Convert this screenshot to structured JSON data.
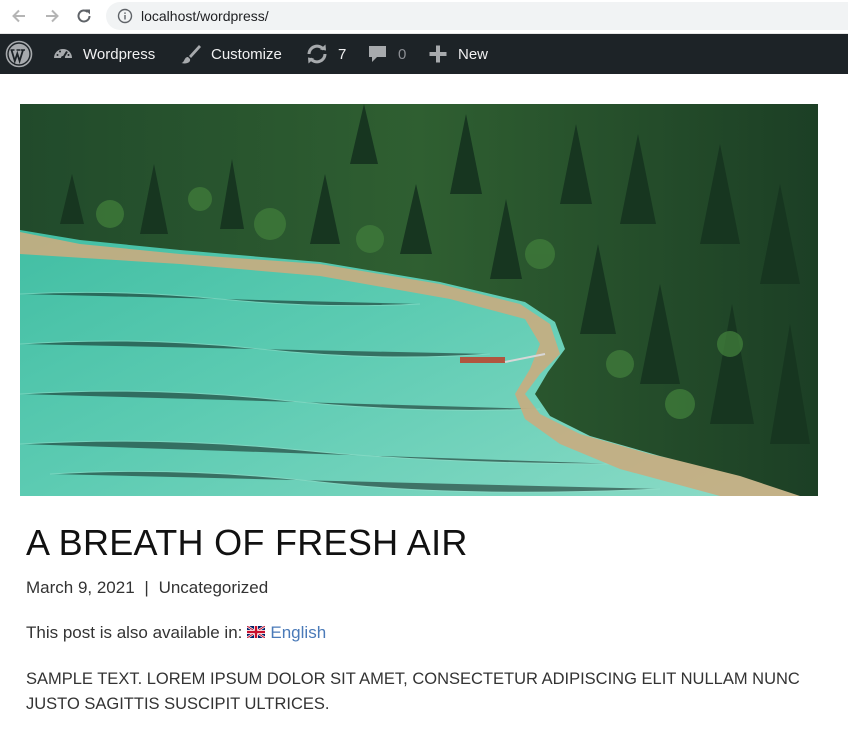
{
  "browser": {
    "url": "localhost/wordpress/"
  },
  "admin_bar": {
    "site_name": "Wordpress",
    "customize_label": "Customize",
    "updates_count": "7",
    "comments_count": "0",
    "new_label": "New"
  },
  "post": {
    "title": "A BREATH OF FRESH AIR",
    "date": "March 9, 2021",
    "separator": "|",
    "category": "Uncategorized",
    "also_available_text": "This post is also available in:",
    "language_link": "English",
    "body": "SAMPLE TEXT. LOREM IPSUM DOLOR SIT AMET, CONSECTETUR ADIPISCING ELIT NULLAM NUNC JUSTO SAGITTIS SUSCIPIT ULTRICES."
  },
  "colors": {
    "admin_bar_bg": "#1d2327",
    "link": "#4a7ab8",
    "water": "#4fc3a9",
    "forest": "#1f4a2a"
  }
}
